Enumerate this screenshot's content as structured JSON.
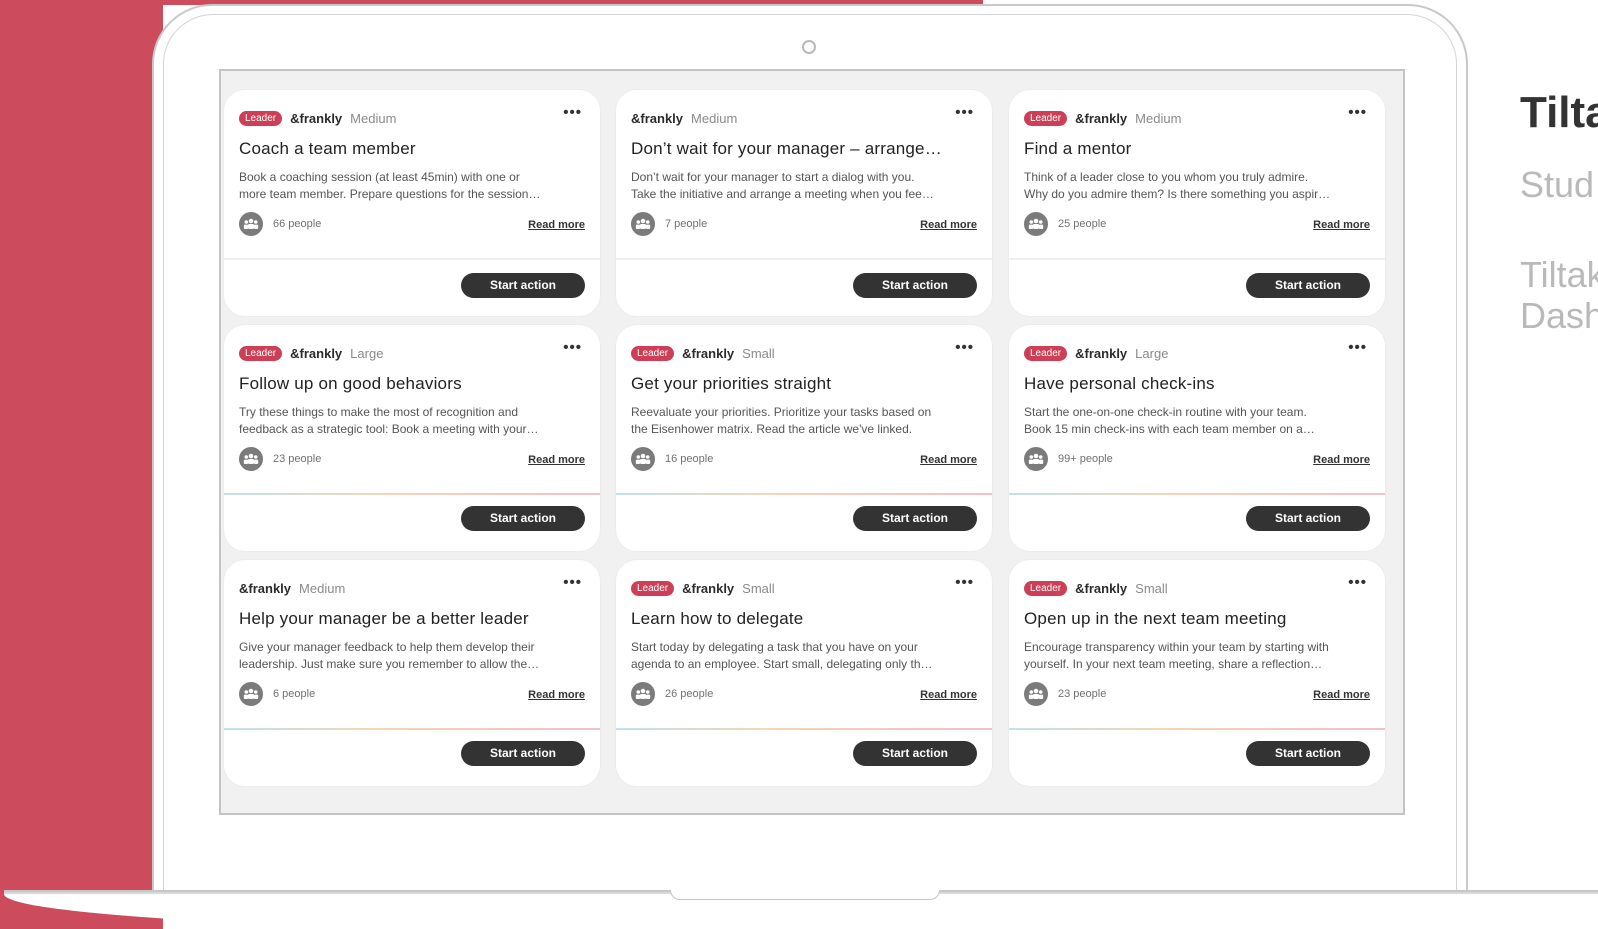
{
  "side_panel": {
    "title": "Tilta",
    "subtitle": "Stud",
    "text_line1": "Tiltak",
    "text_line2": "Dash"
  },
  "cards": [
    {
      "badge": "Leader",
      "brand": "&frankly",
      "size": "Medium",
      "title": "Coach a team member",
      "desc1": "Book a coaching session (at least 45min) with one or",
      "desc2": "more team member. Prepare questions for the session…",
      "people": "66 people",
      "read_more": "Read more",
      "button": "Start action",
      "more": "•••"
    },
    {
      "badge": "",
      "brand": "&frankly",
      "size": "Medium",
      "title": "Don’t wait for your manager – arrange…",
      "desc1": "Don’t wait for your manager to start a dialog with you.",
      "desc2": "Take the initiative and arrange a meeting when you fee…",
      "people": "7 people",
      "read_more": "Read more",
      "button": "Start action",
      "more": "•••"
    },
    {
      "badge": "Leader",
      "brand": "&frankly",
      "size": "Medium",
      "title": "Find a mentor",
      "desc1": "Think of a leader close to you whom you truly admire.",
      "desc2": "Why do you admire them? Is there something you aspir…",
      "people": "25 people",
      "read_more": "Read more",
      "button": "Start action",
      "more": "•••"
    },
    {
      "badge": "Leader",
      "brand": "&frankly",
      "size": "Large",
      "title": "Follow up on good behaviors",
      "desc1": "Try these things to make the most of recognition and",
      "desc2": "feedback as a strategic tool: Book a meeting with your…",
      "people": "23 people",
      "read_more": "Read more",
      "button": "Start action",
      "more": "•••"
    },
    {
      "badge": "Leader",
      "brand": "&frankly",
      "size": "Small",
      "title": "Get your priorities straight",
      "desc1": "Reevaluate your priorities. Prioritize your tasks based on",
      "desc2": "the Eisenhower matrix. Read the article we've linked.",
      "people": "16 people",
      "read_more": "Read more",
      "button": "Start action",
      "more": "•••"
    },
    {
      "badge": "Leader",
      "brand": "&frankly",
      "size": "Large",
      "title": "Have personal check-ins",
      "desc1": "Start the one-on-one check-in routine with your team.",
      "desc2": "Book 15 min check-ins with each team member on a…",
      "people": "99+ people",
      "read_more": "Read more",
      "button": "Start action",
      "more": "•••"
    },
    {
      "badge": "",
      "brand": "&frankly",
      "size": "Medium",
      "title": "Help your manager be a better leader",
      "desc1": "Give your manager feedback to help them develop their",
      "desc2": "leadership. Just make sure you remember to allow the…",
      "people": "6 people",
      "read_more": "Read more",
      "button": "Start action",
      "more": "•••"
    },
    {
      "badge": "Leader",
      "brand": "&frankly",
      "size": "Small",
      "title": "Learn how to delegate",
      "desc1": "Start today by delegating a task that you have on your",
      "desc2": "agenda to an employee. Start small, delegating only th…",
      "people": "26 people",
      "read_more": "Read more",
      "button": "Start action",
      "more": "•••"
    },
    {
      "badge": "Leader",
      "brand": "&frankly",
      "size": "Small",
      "title": "Open up in the next team meeting",
      "desc1": "Encourage transparency within your team by starting with",
      "desc2": "yourself. In your next team meeting, share a reflection…",
      "people": "23 people",
      "read_more": "Read more",
      "button": "Start action",
      "more": "•••"
    }
  ],
  "colors": {
    "accent": "#cc4b5c",
    "badge": "#cc3f56",
    "button": "#333333"
  }
}
